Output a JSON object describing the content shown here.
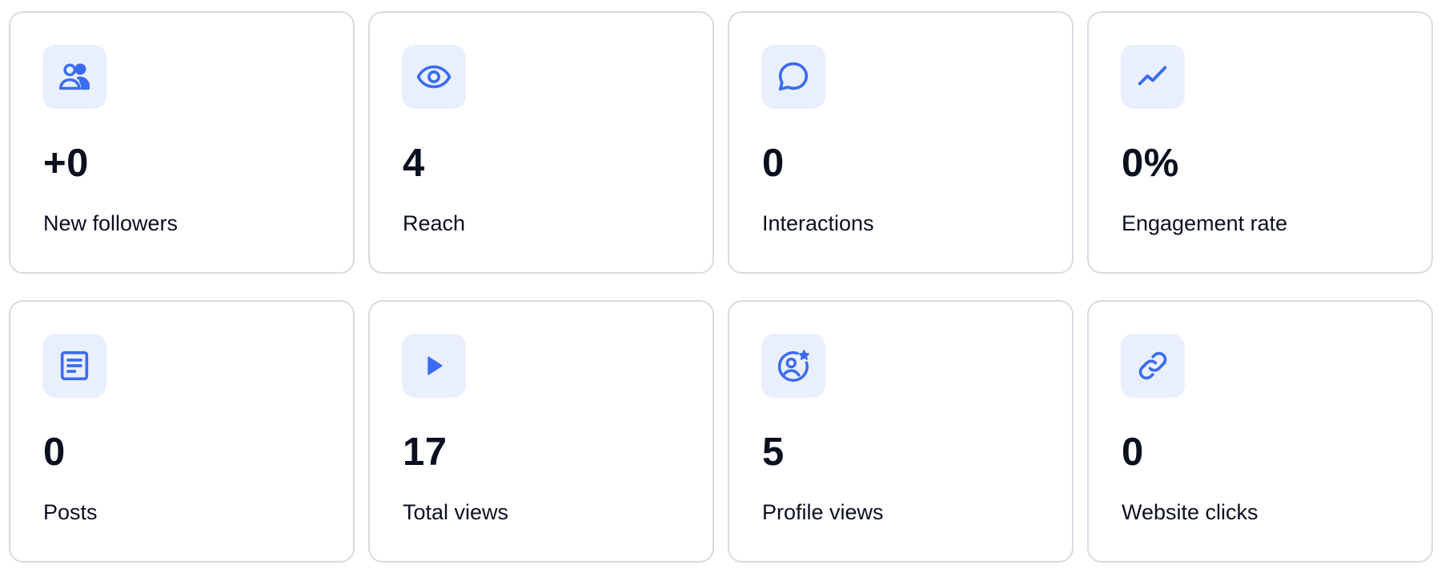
{
  "accent_color": "#3b6cf0",
  "icon_bg_color": "#e9effd",
  "stats": [
    {
      "value": "+0",
      "label": "New followers",
      "icon": "users-icon"
    },
    {
      "value": "4",
      "label": "Reach",
      "icon": "eye-icon"
    },
    {
      "value": "0",
      "label": "Interactions",
      "icon": "chat-bubble-icon"
    },
    {
      "value": "0%",
      "label": "Engagement rate",
      "icon": "trend-line-icon"
    },
    {
      "value": "0",
      "label": "Posts",
      "icon": "document-icon"
    },
    {
      "value": "17",
      "label": "Total views",
      "icon": "play-icon"
    },
    {
      "value": "5",
      "label": "Profile views",
      "icon": "profile-star-icon"
    },
    {
      "value": "0",
      "label": "Website clicks",
      "icon": "link-icon"
    }
  ]
}
